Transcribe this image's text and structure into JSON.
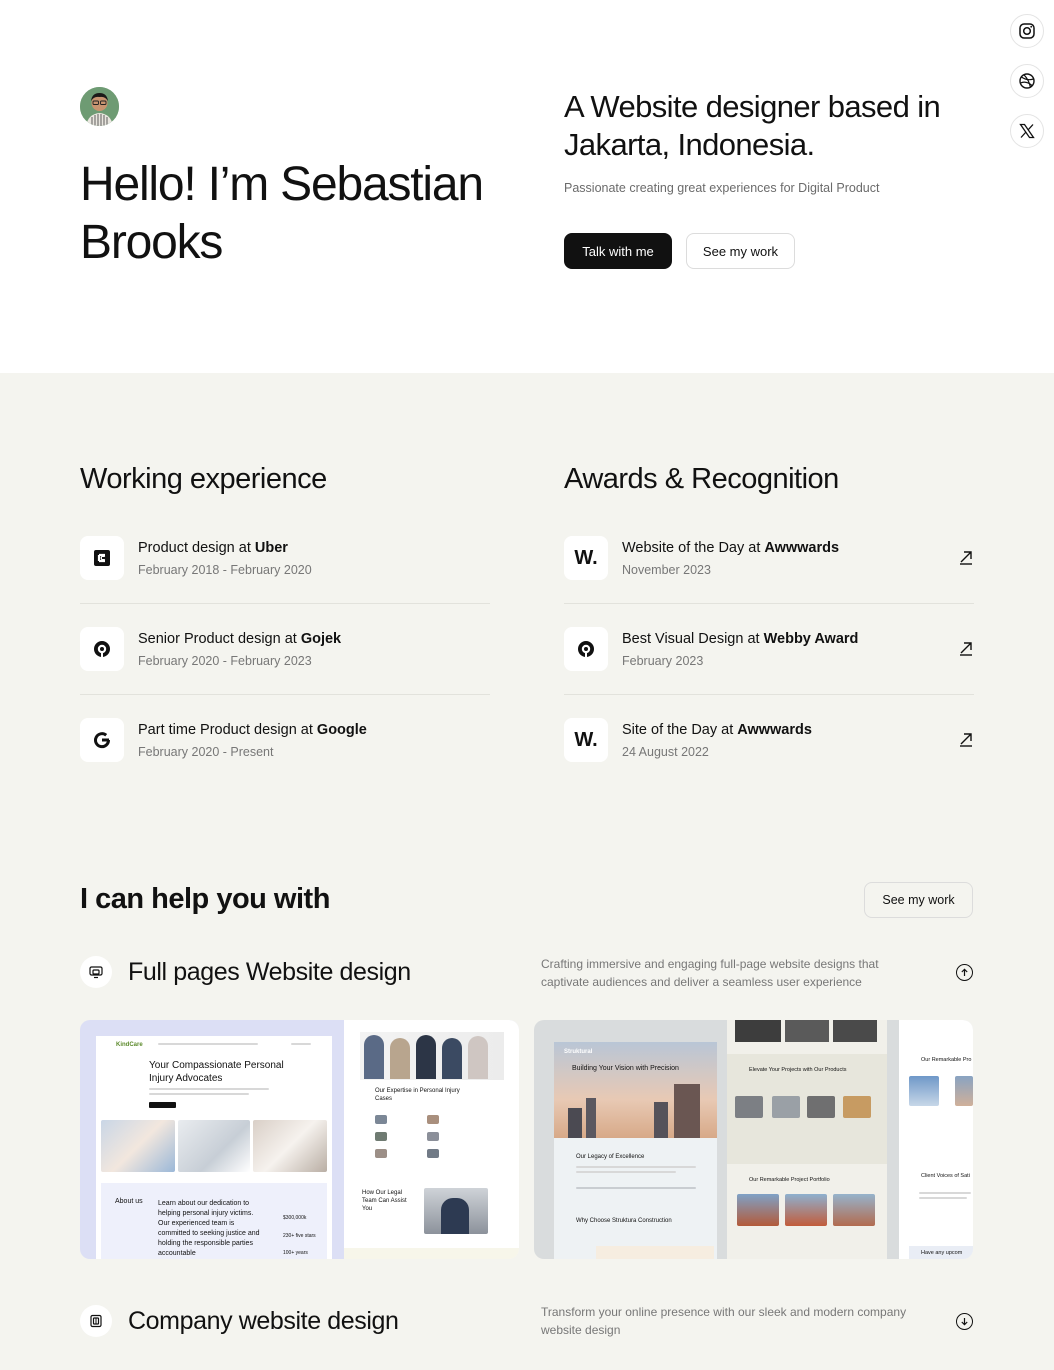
{
  "social": [
    {
      "name": "instagram",
      "icon": "instagram-icon"
    },
    {
      "name": "dribbble",
      "icon": "dribbble-icon"
    },
    {
      "name": "x",
      "icon": "x-icon"
    }
  ],
  "hero": {
    "greeting": "Hello! I’m Sebastian Brooks",
    "headline": "A Website designer based in Jakarta, Indonesia.",
    "subtitle": "Passionate creating great experiences for Digital Product",
    "primary_cta": "Talk with me",
    "secondary_cta": "See my work"
  },
  "experience": {
    "title": "Working experience",
    "items": [
      {
        "role": "Product design at ",
        "company": "Uber",
        "dates": "February 2018 - February 2020",
        "logo": "uber-logo-icon"
      },
      {
        "role": "Senior Product design at ",
        "company": "Gojek",
        "dates": "February 2020 - February 2023",
        "logo": "gojek-logo-icon"
      },
      {
        "role": "Part time Product design at ",
        "company": "Google",
        "dates": "February 2020 - Present",
        "logo": "google-logo-icon"
      }
    ]
  },
  "awards": {
    "title": "Awards & Recognition",
    "items": [
      {
        "award": "Website of the Day at ",
        "org": "Awwwards",
        "date": "November 2023",
        "logo_text": "W."
      },
      {
        "award": "Best Visual Design at ",
        "org": "Webby Award",
        "date": "February 2023",
        "logo_text": ""
      },
      {
        "award": "Site of the Day at ",
        "org": "Awwwards",
        "date": "24 August 2022",
        "logo_text": "W."
      }
    ]
  },
  "services": {
    "title": "I can help you with",
    "see_work": "See my work",
    "items": [
      {
        "title": "Full pages Website design",
        "description": "Crafting immersive and engaging full-page website designs that captivate audiences and deliver a seamless user experience"
      },
      {
        "title": "Company website design",
        "description": "Transform your online presence with our sleek and modern company website design"
      }
    ]
  },
  "preview_law": {
    "brand": "KindCare",
    "headline": "Your Compassionate Personal Injury Advocates",
    "about_label": "About us",
    "about_text": "Learn about our dedication to helping personal injury victims. Our experienced team is committed to seeking justice and holding the responsible parties accountable",
    "stat1": "$300,000k",
    "stat2": "230+ five stars",
    "stat3": "100+ years",
    "expertise": "Our Expertise in Personal Injury Cases",
    "legal_team": "How Our Legal Team Can Assist You"
  },
  "preview_construction": {
    "brand": "Struktural",
    "headline": "Building Your Vision with Precision",
    "legacy": "Our Legacy of Excellence",
    "why": "Why Choose Struktura Construction",
    "products": "Elevate Your Projects with Our Products",
    "portfolio": "Our Remarkable Project Portfolio",
    "portfolio_partial": "Our Remarkable Pro",
    "clients": "Client Voices of Sati",
    "upcoming": "Have any upcom"
  }
}
